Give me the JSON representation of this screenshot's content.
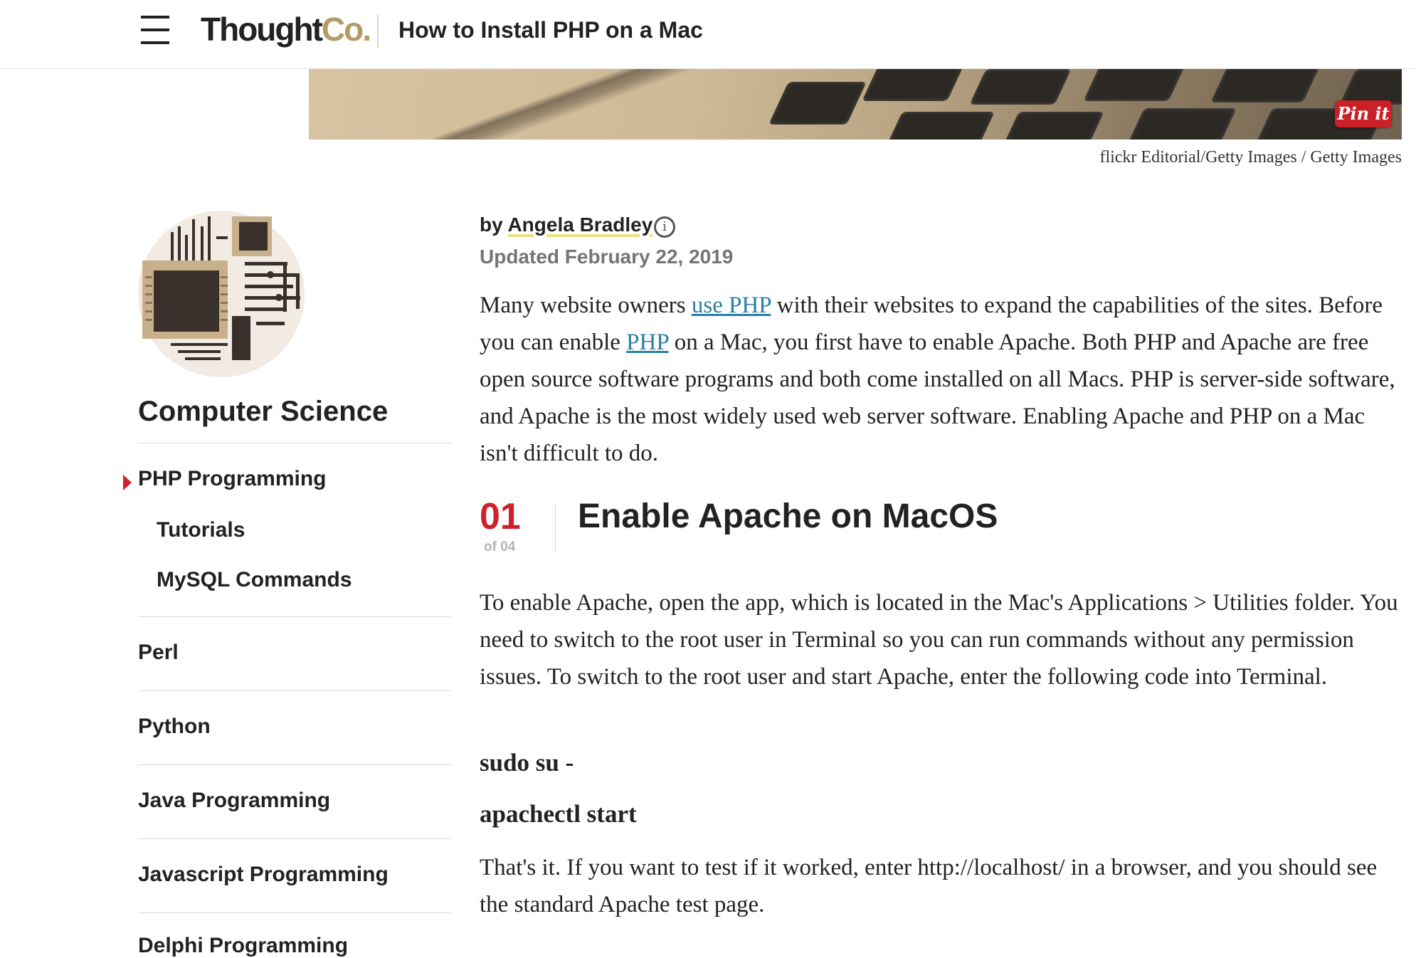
{
  "header": {
    "logo_main": "Thought",
    "logo_accent": "Co.",
    "title": "How to Install PHP on a Mac"
  },
  "hero": {
    "pin_label": "Pin it",
    "credit": "flickr Editorial/Getty Images / Getty Images"
  },
  "sidebar": {
    "heading": "Computer Science",
    "items": [
      {
        "label": "PHP Programming",
        "active": true
      },
      {
        "label": "Tutorials"
      },
      {
        "label": "MySQL Commands"
      },
      {
        "label": "Perl"
      },
      {
        "label": "Python"
      },
      {
        "label": "Java Programming"
      },
      {
        "label": "Javascript Programming"
      },
      {
        "label": "Delphi Programming"
      }
    ]
  },
  "article": {
    "by_prefix": "by",
    "author": "Angela Bradley",
    "info_glyph": "i",
    "updated": "Updated February 22, 2019",
    "intro": {
      "t1": "Many website owners ",
      "link1": "use PHP",
      "t2": " with their websites to expand the capabilities of the sites. Before you can enable ",
      "link2": "PHP",
      "t3": " on a Mac, you first have to enable Apache. Both PHP and Apache are free open source software programs and both come installed on all Macs. PHP is server-side software, and Apache is the most widely used web server software. Enabling Apache and PHP on a Mac isn't difficult to do."
    },
    "step": {
      "number": "01",
      "of": "of 04",
      "title": "Enable Apache on MacOS"
    },
    "step_body": "To enable Apache, open the app, which is located in the Mac's Applications > Utilities folder. You need to switch to the root user in Terminal so you can run commands without any permission issues. To switch to the root user and start Apache, enter the following code into Terminal.",
    "code1": "sudo su -",
    "code2": "apachectl start",
    "closing": "That's it. If you want to test if it worked, enter http://localhost/ in a browser, and you should see the standard Apache test page."
  },
  "colors": {
    "accent_red": "#d0202a",
    "link_blue": "#2a7fa3",
    "logo_gold": "#b49a63",
    "pinterest_red": "#cb2027"
  },
  "icons": [
    "menu-icon",
    "info-icon",
    "caret-right-icon"
  ]
}
